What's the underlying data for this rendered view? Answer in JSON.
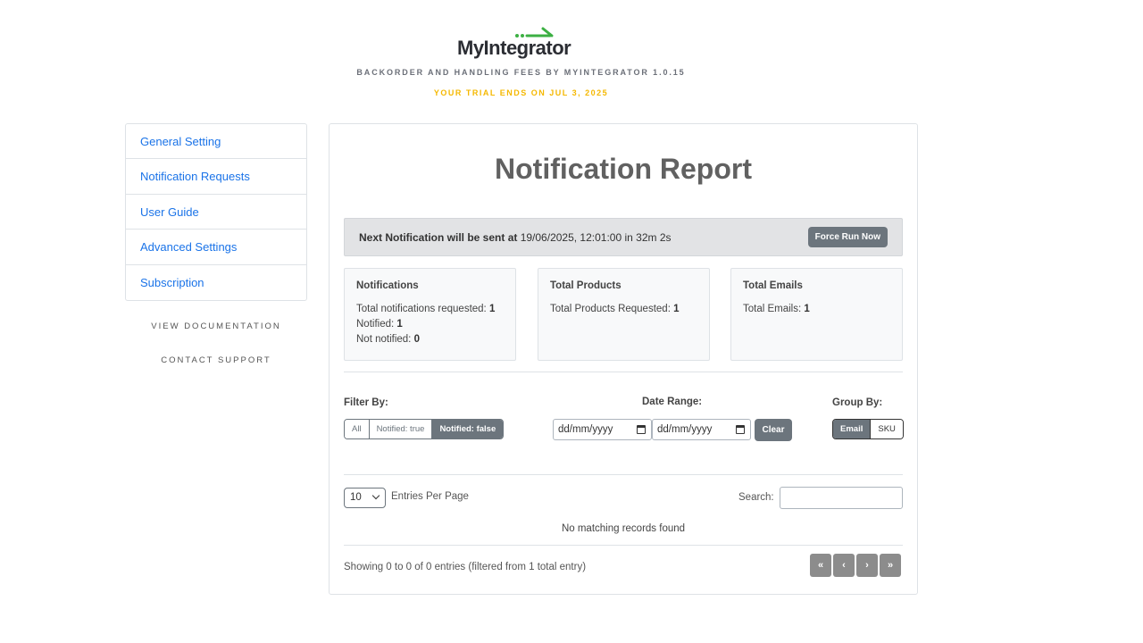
{
  "brand": {
    "logo_text": "MyIntegrator",
    "subtitle": "BACKORDER AND HANDLING FEES BY MYINTEGRATOR 1.0.15",
    "trial_notice": "YOUR TRIAL ENDS ON JUL 3, 2025",
    "accent_color": "#3cb043",
    "trial_color": "#f5b800"
  },
  "sidebar": {
    "items": [
      {
        "label": "General Setting"
      },
      {
        "label": "Notification Requests"
      },
      {
        "label": "User Guide"
      },
      {
        "label": "Advanced Settings"
      },
      {
        "label": "Subscription"
      }
    ],
    "view_documentation": "VIEW DOCUMENTATION",
    "contact_support": "CONTACT SUPPORT"
  },
  "main": {
    "title": "Notification Report",
    "next_notification": {
      "label": "Next Notification will be sent at",
      "value": "19/06/2025, 12:01:00 in 32m 2s",
      "button": "Force Run Now"
    },
    "stats": [
      {
        "title": "Notifications",
        "lines": [
          {
            "label": "Total notifications requested: ",
            "value": "1"
          },
          {
            "label": "Notified: ",
            "value": "1"
          },
          {
            "label": "Not notified: ",
            "value": "0"
          }
        ]
      },
      {
        "title": "Total Products",
        "lines": [
          {
            "label": "Total Products Requested: ",
            "value": "1"
          }
        ]
      },
      {
        "title": "Total Emails",
        "lines": [
          {
            "label": "Total Emails: ",
            "value": "1"
          }
        ]
      }
    ],
    "filter": {
      "label": "Filter By:",
      "options": [
        "All",
        "Notified: true",
        "Notified: false"
      ],
      "selected": "Notified: false"
    },
    "date_range": {
      "label": "Date Range:",
      "from_placeholder": "dd/mm/yyyy",
      "to_placeholder": "dd/mm/yyyy",
      "clear": "Clear"
    },
    "group_by": {
      "label": "Group By:",
      "options": [
        "Email",
        "SKU"
      ],
      "selected": "Email"
    },
    "table": {
      "page_size": "10",
      "entries_label": "Entries Per Page",
      "search_label": "Search:",
      "search_value": "",
      "empty_text": "No matching records found",
      "info": "Showing 0 to 0 of 0 entries (filtered from 1 total entry)",
      "pager": [
        "«",
        "‹",
        "›",
        "»"
      ]
    }
  }
}
